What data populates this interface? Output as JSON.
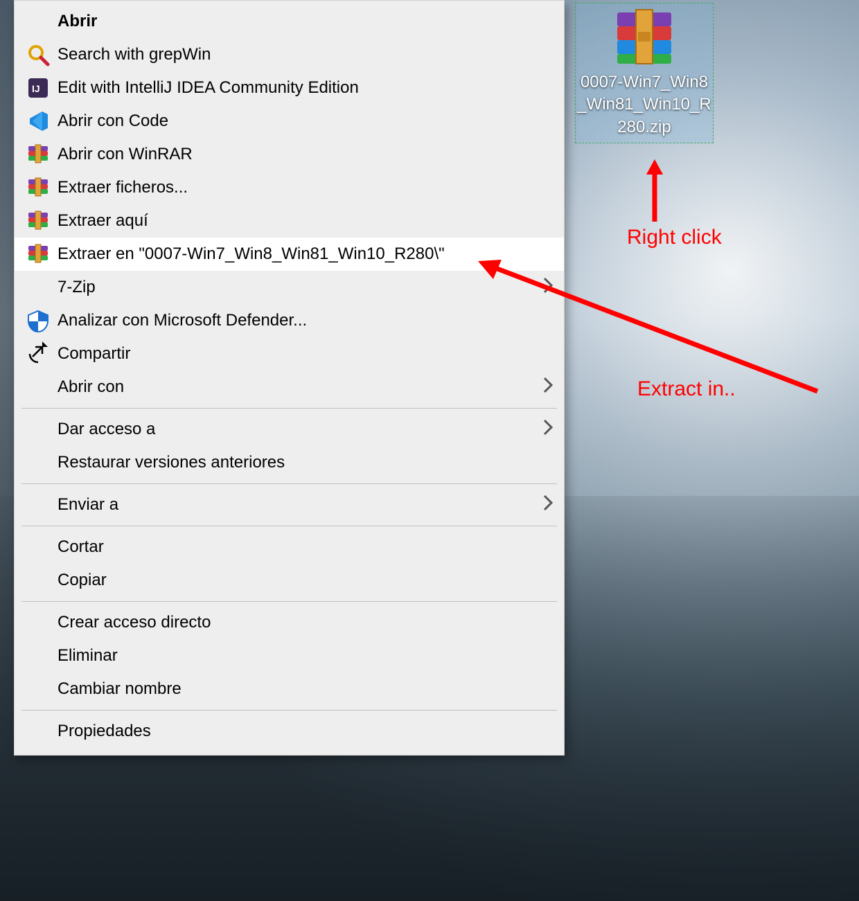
{
  "desktop": {
    "file_label": "0007-Win7_Win8_Win81_Win10_R280.zip"
  },
  "annotations": {
    "right_click": "Right click",
    "extract_in": "Extract in.."
  },
  "menu": {
    "items": [
      {
        "key": "open",
        "label": "Abrir",
        "bold": true,
        "icon": "none"
      },
      {
        "key": "grepwin",
        "label": "Search with grepWin",
        "icon": "search"
      },
      {
        "key": "intellij",
        "label": "Edit with IntelliJ IDEA Community Edition",
        "icon": "intellij"
      },
      {
        "key": "vscode",
        "label": "Abrir con Code",
        "icon": "vscode"
      },
      {
        "key": "winrar-open",
        "label": "Abrir con WinRAR",
        "icon": "winrar"
      },
      {
        "key": "winrar-extract",
        "label": "Extraer ficheros...",
        "icon": "winrar"
      },
      {
        "key": "winrar-here",
        "label": "Extraer aquí",
        "icon": "winrar"
      },
      {
        "key": "winrar-to",
        "label": "Extraer en \"0007-Win7_Win8_Win81_Win10_R280\\\"",
        "icon": "winrar",
        "hover": true
      },
      {
        "key": "7zip",
        "label": "7-Zip",
        "icon": "none",
        "submenu": true
      },
      {
        "key": "defender",
        "label": "Analizar con Microsoft Defender...",
        "icon": "shield"
      },
      {
        "key": "share",
        "label": "Compartir",
        "icon": "share"
      },
      {
        "key": "openwith",
        "label": "Abrir con",
        "icon": "none",
        "submenu": true
      },
      {
        "sep": true
      },
      {
        "key": "giveaccess",
        "label": "Dar acceso a",
        "icon": "none",
        "submenu": true
      },
      {
        "key": "restore",
        "label": "Restaurar versiones anteriores",
        "icon": "none"
      },
      {
        "sep": true
      },
      {
        "key": "sendto",
        "label": "Enviar a",
        "icon": "none",
        "submenu": true
      },
      {
        "sep": true
      },
      {
        "key": "cut",
        "label": "Cortar",
        "icon": "none"
      },
      {
        "key": "copy",
        "label": "Copiar",
        "icon": "none"
      },
      {
        "sep": true
      },
      {
        "key": "shortcut",
        "label": "Crear acceso directo",
        "icon": "none"
      },
      {
        "key": "delete",
        "label": "Eliminar",
        "icon": "none"
      },
      {
        "key": "rename",
        "label": "Cambiar nombre",
        "icon": "none"
      },
      {
        "sep": true
      },
      {
        "key": "properties",
        "label": "Propiedades",
        "icon": "none"
      }
    ]
  }
}
